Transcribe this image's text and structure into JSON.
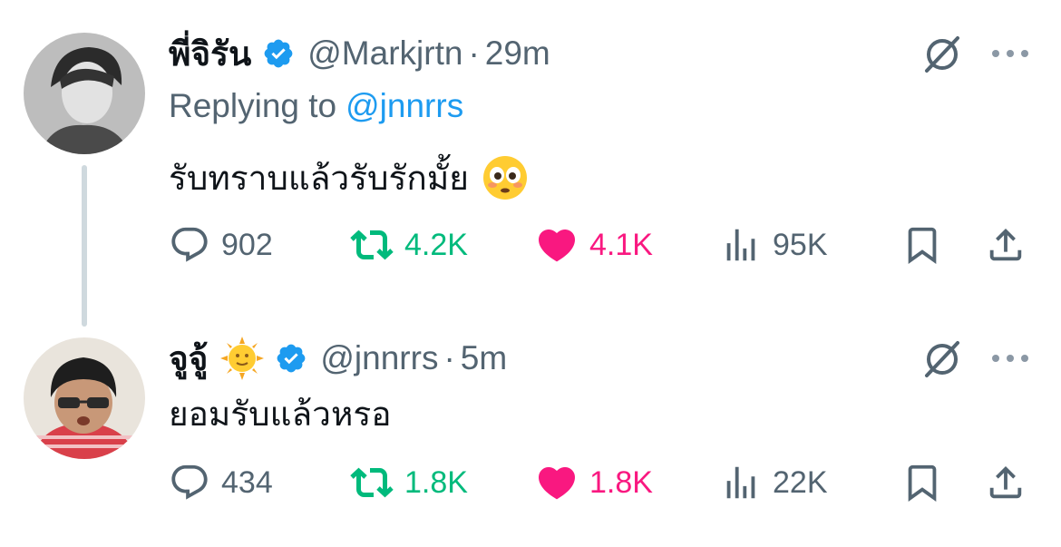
{
  "tweets": [
    {
      "name": "พี่จิรัน",
      "handle": "@Markjrtn",
      "separator": "·",
      "time": "29m",
      "replying_prefix": "Replying to",
      "replying_to": "@jnnrrs",
      "text": "รับทราบแล้วรับรักมั้ย",
      "emoji": "flushed-face-emoji",
      "replies": "902",
      "retweets": "4.2K",
      "likes": "4.1K",
      "views": "95K"
    },
    {
      "name": "จูจู้",
      "name_emoji": "sun-with-face-emoji",
      "handle": "@jnnrrs",
      "separator": "·",
      "time": "5m",
      "text": "ยอมรับแล้วหรอ",
      "replies": "434",
      "retweets": "1.8K",
      "likes": "1.8K",
      "views": "22K"
    }
  ],
  "colors": {
    "verified": "#1d9bf0",
    "retweet_active": "#00ba7c",
    "like_active": "#f91880",
    "secondary_text": "#536471",
    "thread_line": "#cfd9de"
  },
  "icons": [
    "reply-icon",
    "retweet-icon",
    "like-icon",
    "views-icon",
    "bookmark-icon",
    "share-icon",
    "grok-icon",
    "more-icon",
    "verified-icon"
  ]
}
